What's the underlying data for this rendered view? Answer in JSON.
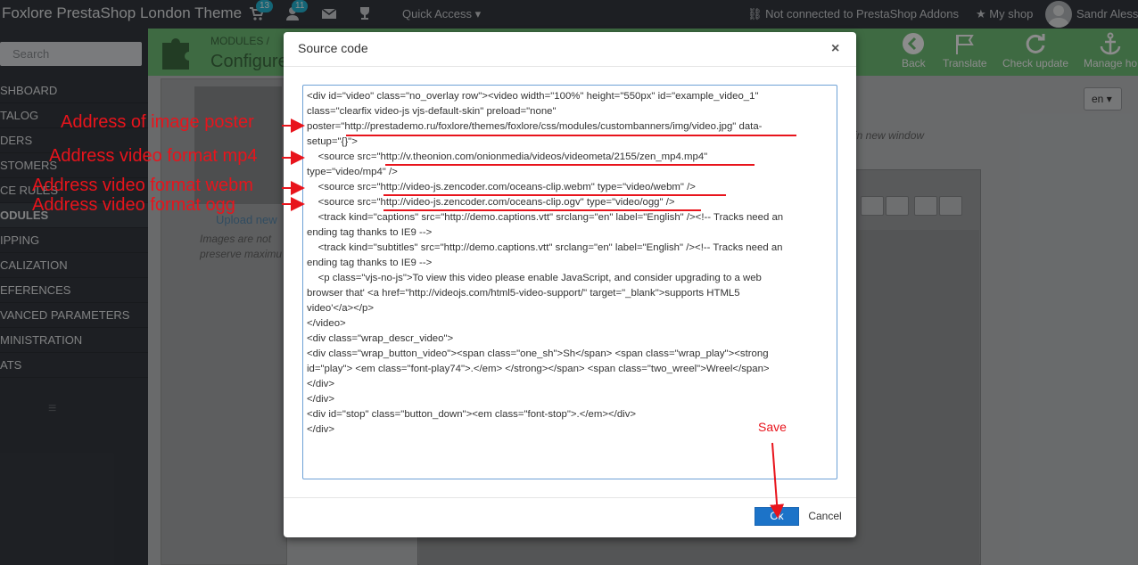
{
  "topbar": {
    "shop_title": "Foxlore PrestaShop London Theme",
    "orders_badge": "13",
    "customers_badge": "11",
    "quick_access": "Quick Access",
    "addons_status": "Not connected to PrestaShop Addons",
    "my_shop": "My shop",
    "user_name": "Sandr Alessss"
  },
  "sidebar": {
    "search_placeholder": "Search",
    "items": [
      {
        "label": "SHBOARD"
      },
      {
        "label": "TALOG"
      },
      {
        "label": "DERS"
      },
      {
        "label": "STOMERS"
      },
      {
        "label": "CE RULES"
      },
      {
        "label": "ODULES"
      },
      {
        "label": "IPPING"
      },
      {
        "label": "CALIZATION"
      },
      {
        "label": "EFERENCES"
      },
      {
        "label": "VANCED PARAMETERS"
      },
      {
        "label": "MINISTRATION"
      },
      {
        "label": "ATS"
      }
    ]
  },
  "page_header": {
    "breadcrumb": "MODULES  /",
    "title": "Configure",
    "toolbar": {
      "back": "Back",
      "translate": "Translate",
      "check_update": "Check update",
      "manage_hooks": "Manage ho"
    }
  },
  "background": {
    "upload_new": "Upload new",
    "hint_line1": "Images are not",
    "hint_line2": "preserve maximu",
    "language": "en",
    "new_window": "in new window"
  },
  "modal": {
    "title": "Source code",
    "close": "×",
    "source_lines": [
      "<div id=\"video\" class=\"no_overlay row\"><video width=\"100%\" height=\"550px\" id=\"example_video_1\"",
      "class=\"clearfix video-js vjs-default-skin\" preload=\"none\"",
      "poster=\"http://prestademo.ru/foxlore/themes/foxlore/css/modules/custombanners/img/video.jpg\" data-",
      "setup=\"{}\">",
      "    <source src=\"http://v.theonion.com/onionmedia/videos/videometa/2155/zen_mp4.mp4\"",
      "type=\"video/mp4\" />",
      "    <source src=\"http://video-js.zencoder.com/oceans-clip.webm\" type=\"video/webm\" />",
      "    <source src=\"http://video-js.zencoder.com/oceans-clip.ogv\" type=\"video/ogg\" />",
      "    <track kind=\"captions\" src=\"http://demo.captions.vtt\" srclang=\"en\" label=\"English\" /><!-- Tracks need an",
      "ending tag thanks to IE9 -->",
      "    <track kind=\"subtitles\" src=\"http://demo.captions.vtt\" srclang=\"en\" label=\"English\" /><!-- Tracks need an",
      "ending tag thanks to IE9 -->",
      "    <p class=\"vjs-no-js\">To view this video please enable JavaScript, and consider upgrading to a web",
      "browser that' <a href=\"http://videojs.com/html5-video-support/\" target=\"_blank\">supports HTML5",
      "video'</a></p>",
      "</video>",
      "<div class=\"wrap_descr_video\">",
      "<div class=\"wrap_button_video\"><span class=\"one_sh\">Sh</span> <span class=\"wrap_play\"><strong",
      "id=\"play\"> <em class=\"font-play74\">.</em> </strong></span> <span class=\"two_wreel\">Wreel</span>",
      "</div>",
      "</div>",
      "<div id=\"stop\" class=\"button_down\"><em class=\"font-stop\">.</em></div>",
      "</div>"
    ],
    "ok": "Ok",
    "cancel": "Cancel"
  },
  "annotations": {
    "poster": "Address  of image poster",
    "mp4": "Address video format mp4",
    "webm": "Address video format webm",
    "ogg": "Address video format ogg",
    "save": "Save"
  },
  "colors": {
    "annotation": "#e8141c",
    "header_green": "#72c279",
    "topbar": "#363a41",
    "primary_button": "#1c73c8"
  }
}
